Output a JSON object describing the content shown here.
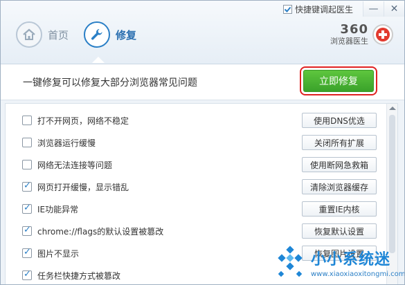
{
  "topbar": {
    "hotkey_label": "快捷键调起医生",
    "hotkey_checked": true,
    "minimize_icon": "minimize-icon",
    "close_icon": "close-icon"
  },
  "nav": {
    "home_label": "首页",
    "home_icon": "home-icon",
    "repair_label": "修复",
    "repair_icon": "wrench-icon",
    "active": "repair"
  },
  "brand": {
    "name": "360",
    "subtitle": "浏览器医生",
    "logo_icon": "red-cross-icon"
  },
  "banner": {
    "text": "一键修复可以修复大部分浏览器常见问题",
    "fix_button": "立即修复",
    "accent": "#3aa22a",
    "highlight_color": "#e02020"
  },
  "issues": [
    {
      "label": "打不开网页，网络不稳定",
      "checked": false,
      "action": "使用DNS优选"
    },
    {
      "label": "浏览器运行缓慢",
      "checked": false,
      "action": "关闭所有扩展"
    },
    {
      "label": "网络无法连接等问题",
      "checked": false,
      "action": "使用断网急救箱"
    },
    {
      "label": "网页打开缓慢，显示错乱",
      "checked": true,
      "action": "清除浏览器缓存"
    },
    {
      "label": "IE功能异常",
      "checked": true,
      "action": "重置IE内核"
    },
    {
      "label": "chrome://flags的默认设置被篡改",
      "checked": true,
      "action": "恢复默认设置"
    },
    {
      "label": "图片不显示",
      "checked": true,
      "action": "恢复图片设置"
    },
    {
      "label": "任务栏快捷方式被篡改",
      "checked": true,
      "action": ""
    }
  ],
  "watermark": {
    "title": "小小系统迷",
    "url": "www.xiaoxiaoxitongmi.com"
  }
}
